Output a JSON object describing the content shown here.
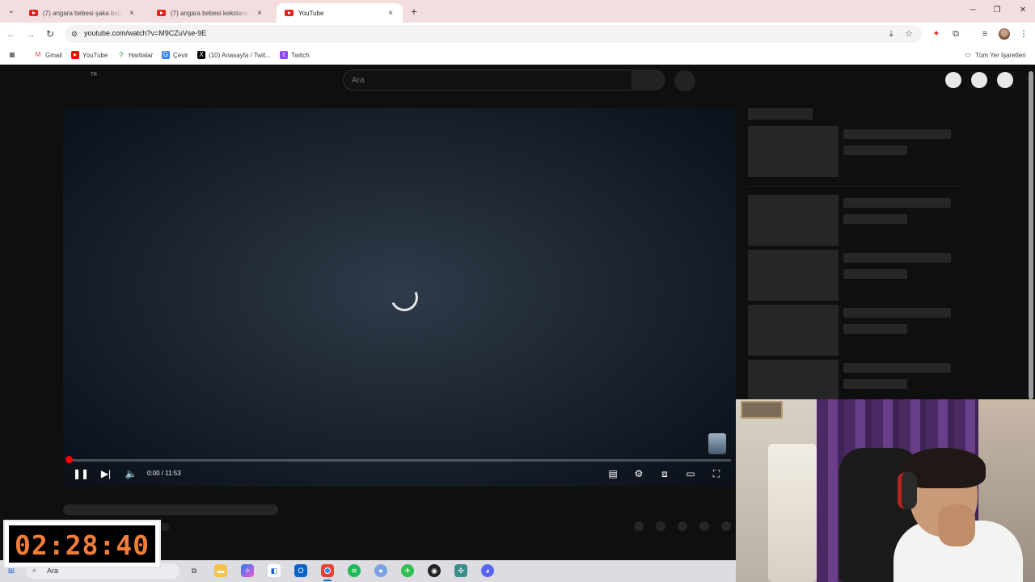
{
  "browser": {
    "tabs": [
      {
        "title": "(7) angara bebesi şaka baba - Y",
        "active": false
      },
      {
        "title": "(7) angara bebesi kekolara tikir",
        "active": false
      },
      {
        "title": "YouTube",
        "active": true
      }
    ],
    "close_glyph": "×",
    "new_tab_glyph": "+",
    "url": "youtube.com/watch?v=M9CZuVse-9E",
    "bookmarks": [
      {
        "label": "Gmail",
        "icon": "gmail-icon",
        "color": "#ea4335"
      },
      {
        "label": "YouTube",
        "icon": "youtube-icon",
        "color": "#ff0000"
      },
      {
        "label": "Haritalar",
        "icon": "maps-icon",
        "color": "#34a853"
      },
      {
        "label": "Çevir",
        "icon": "translate-icon",
        "color": "#4285f4"
      },
      {
        "label": "(10) Anasayfa / Twit...",
        "icon": "x-icon",
        "color": "#000000"
      },
      {
        "label": "Twitch",
        "icon": "twitch-icon",
        "color": "#9146ff"
      }
    ],
    "all_bookmarks": "Tüm Yer İşaretleri"
  },
  "youtube": {
    "region": "TR",
    "search_placeholder": "Ara",
    "player": {
      "current_time": "0:00",
      "separator": " / ",
      "duration": "11:53",
      "progress": 0.003
    }
  },
  "overlay": {
    "timer": "02:28:40"
  },
  "taskbar": {
    "search_label": "Ara",
    "apps": [
      "task-view-icon",
      "file-explorer-icon",
      "copilot-icon",
      "store-icon",
      "outlook-icon",
      "chrome-icon",
      "spotify-icon",
      "app-blue-icon",
      "app-green-icon",
      "app-red-icon",
      "app-gear-icon",
      "discord-icon"
    ]
  },
  "colors": {
    "accent_red": "#ff0000",
    "timer_orange": "#f07d3a",
    "page_bg": "#0f0f0f",
    "tabstrip_bg": "#f2dede"
  }
}
